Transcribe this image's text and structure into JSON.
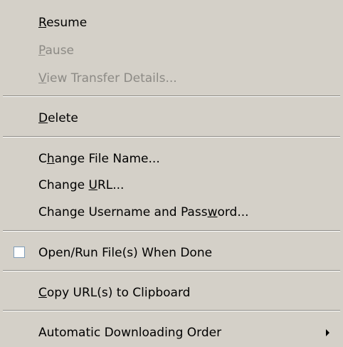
{
  "menu": {
    "items": {
      "resume": {
        "pre": "",
        "key": "R",
        "post": "esume",
        "enabled": true
      },
      "pause": {
        "pre": "",
        "key": "P",
        "post": "ause",
        "enabled": false
      },
      "view_details": {
        "pre": "",
        "key": "V",
        "post": "iew Transfer Details...",
        "enabled": false
      },
      "delete": {
        "pre": "",
        "key": "D",
        "post": "elete",
        "enabled": true
      },
      "change_file_name": {
        "pre": "C",
        "key": "h",
        "post": "ange File Name...",
        "enabled": true
      },
      "change_url": {
        "pre": "Change ",
        "key": "U",
        "post": "RL...",
        "enabled": true
      },
      "change_credentials": {
        "pre": "Change Username and Pass",
        "key": "w",
        "post": "ord...",
        "enabled": true
      },
      "open_run_when_done": {
        "label": "Open/Run File(s) When Done",
        "checked": false,
        "enabled": true
      },
      "copy_url": {
        "pre": "",
        "key": "C",
        "post": "opy URL(s) to Clipboard",
        "enabled": true
      },
      "download_order": {
        "label": "Automatic Downloading Order",
        "has_submenu": true,
        "enabled": true
      }
    },
    "colors": {
      "background": "#d4d0c8",
      "disabled_text": "#8c8a85",
      "separator_dark": "#8c8a85",
      "separator_light": "#ffffff",
      "checkbox_border": "#7f9db9"
    }
  }
}
